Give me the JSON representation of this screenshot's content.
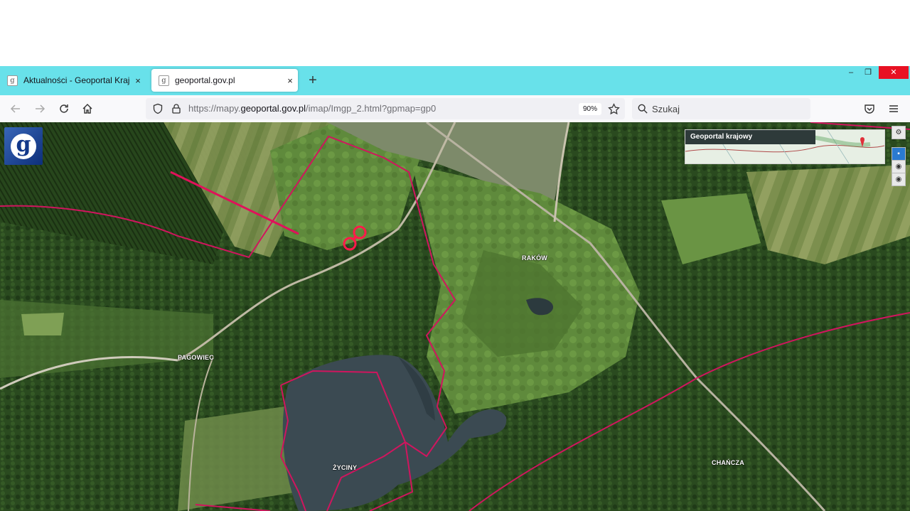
{
  "browser": {
    "tabs": [
      {
        "title": "Aktualności - Geoportal Krajowy",
        "active": false
      },
      {
        "title": "geoportal.gov.pl",
        "active": true
      }
    ],
    "tab_close_glyph": "×",
    "new_tab_glyph": "+",
    "window_controls": {
      "minimize": "–",
      "restore": "❐",
      "close": "✕"
    },
    "url_prefix": "https://mapy.",
    "url_domain": "geoportal.gov.pl",
    "url_suffix": "/imap/Imgp_2.html?gpmap=gp0",
    "zoom": "90%",
    "search_placeholder": "Szukaj",
    "accent_color": "#68e1ea",
    "icons": [
      "back-icon",
      "forward-icon",
      "reload-icon",
      "home-icon",
      "shield-icon",
      "lock-icon",
      "star-icon",
      "search-icon",
      "pocket-icon",
      "menu-icon"
    ]
  },
  "map": {
    "logo_glyph": "g",
    "overview_title": "Geoportal krajowy",
    "controls": [
      "layers-icon",
      "zoom-in-icon",
      "eye-icon",
      "eye-icon"
    ],
    "labels": {
      "rakow": "RAKÓW",
      "pagowiec": "PAGOWIEC",
      "zyciny": "ŻYCINY",
      "chancza": "CHAŃCZA"
    },
    "boundary_color": "#d0155e",
    "marker_color": "#ff1a4a"
  }
}
